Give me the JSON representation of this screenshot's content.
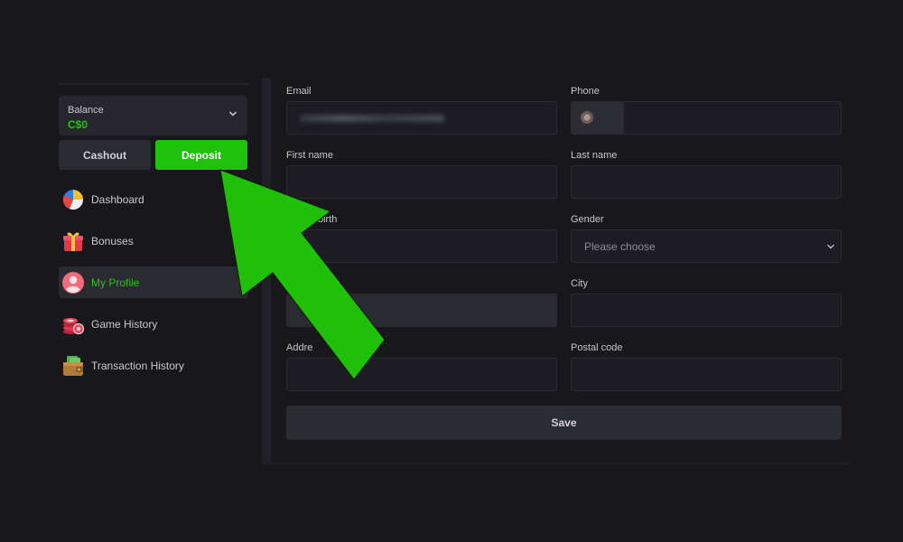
{
  "sidebar": {
    "balance": {
      "label": "Balance",
      "value": "C$0"
    },
    "cashout_label": "Cashout",
    "deposit_label": "Deposit",
    "items": [
      {
        "label": "Dashboard",
        "icon": "pie-chart-icon",
        "active": false
      },
      {
        "label": "Bonuses",
        "icon": "gift-icon",
        "active": false
      },
      {
        "label": "My Profile",
        "icon": "user-avatar-icon",
        "active": true
      },
      {
        "label": "Game History",
        "icon": "casino-chips-icon",
        "active": false
      },
      {
        "label": "Transaction History",
        "icon": "wallet-icon",
        "active": false
      }
    ]
  },
  "form": {
    "email": {
      "label": "Email"
    },
    "phone": {
      "label": "Phone"
    },
    "first_name": {
      "label": "First name"
    },
    "last_name": {
      "label": "Last name"
    },
    "date_of_birth": {
      "label": "birth"
    },
    "gender": {
      "label": "Gender",
      "value": "Please choose"
    },
    "country": {
      "label": ""
    },
    "city": {
      "label": "City"
    },
    "address": {
      "label": "Addre"
    },
    "postal_code": {
      "label": "Postal code"
    },
    "save_label": "Save"
  },
  "colors": {
    "accent": "#1fc10c",
    "background": "#17171c",
    "panel": "#26262c"
  }
}
